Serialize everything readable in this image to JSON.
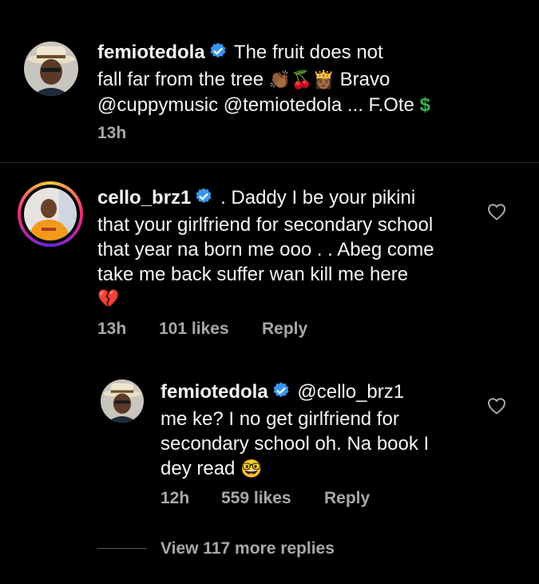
{
  "caption": {
    "username": "femiotedola",
    "text_line1": "The fruit does not",
    "text_line2": "fall far from the tree",
    "emoji_line2": "👏🏾🍒👸🏾",
    "text_line2b": "Bravo",
    "text_line3": "@cuppymusic @temiotedola ... F.Ote",
    "emoji_line3": "$",
    "time": "13h"
  },
  "comment": {
    "username": "cello_brz1",
    "line1": ". Daddy I be your pikini",
    "line2": "that your girlfriend for secondary school",
    "line3": "that year  na born me ooo . . Abeg come",
    "line4": "take me back suffer wan kill me here",
    "emoji": "💔",
    "time": "13h",
    "likes": "101 likes",
    "reply": "Reply"
  },
  "reply": {
    "username": "femiotedola",
    "mention": "@cello_brz1",
    "line2": "me ke? I no get girlfriend for",
    "line3": "secondary school oh. Na book I",
    "line4": "dey read",
    "emoji": "🤓",
    "time": "12h",
    "likes": "559 likes",
    "reply": "Reply"
  },
  "view_more": "View 117 more replies",
  "icons": [
    "verified-badge-icon",
    "heart-icon"
  ],
  "colors": {
    "background": "#000000",
    "verified": "#3897f0",
    "meta": "#a8a8a8",
    "dollar": "#2fb24c"
  }
}
